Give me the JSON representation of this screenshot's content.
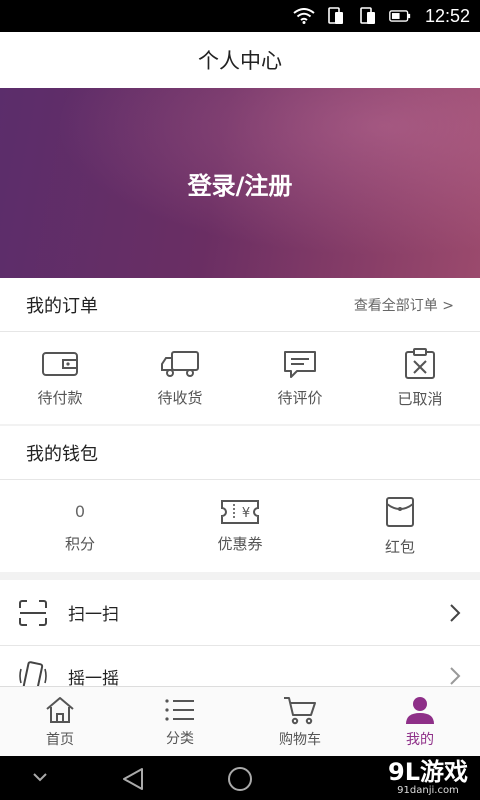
{
  "status_bar": {
    "time": "12:52"
  },
  "header": {
    "title": "个人中心"
  },
  "banner": {
    "login_label": "登录/注册"
  },
  "orders": {
    "title": "我的订单",
    "view_all": "查看全部订单 >",
    "items": [
      {
        "label": "待付款",
        "icon": "wallet-icon"
      },
      {
        "label": "待收货",
        "icon": "truck-icon"
      },
      {
        "label": "待评价",
        "icon": "comment-icon"
      },
      {
        "label": "已取消",
        "icon": "cancel-clipboard-icon"
      }
    ]
  },
  "wallet": {
    "title": "我的钱包",
    "items": [
      {
        "value": "0",
        "label": "积分"
      },
      {
        "label": "优惠券",
        "icon": "coupon-icon",
        "icon_text": "¥"
      },
      {
        "label": "红包",
        "icon": "red-envelope-icon"
      }
    ]
  },
  "list": [
    {
      "label": "扫一扫",
      "icon": "scan-icon"
    },
    {
      "label": "摇一摇",
      "icon": "shake-phone-icon"
    }
  ],
  "tabs": [
    {
      "label": "首页",
      "icon": "home-icon"
    },
    {
      "label": "分类",
      "icon": "list-icon"
    },
    {
      "label": "购物车",
      "icon": "cart-icon"
    },
    {
      "label": "我的",
      "icon": "user-icon",
      "active": true
    }
  ],
  "watermark": {
    "brand": "9L游戏",
    "domain": "91danji.com"
  },
  "colors": {
    "accent": "#8e2f88",
    "banner_start": "#5b2d6b",
    "banner_end": "#9b4a6d"
  }
}
